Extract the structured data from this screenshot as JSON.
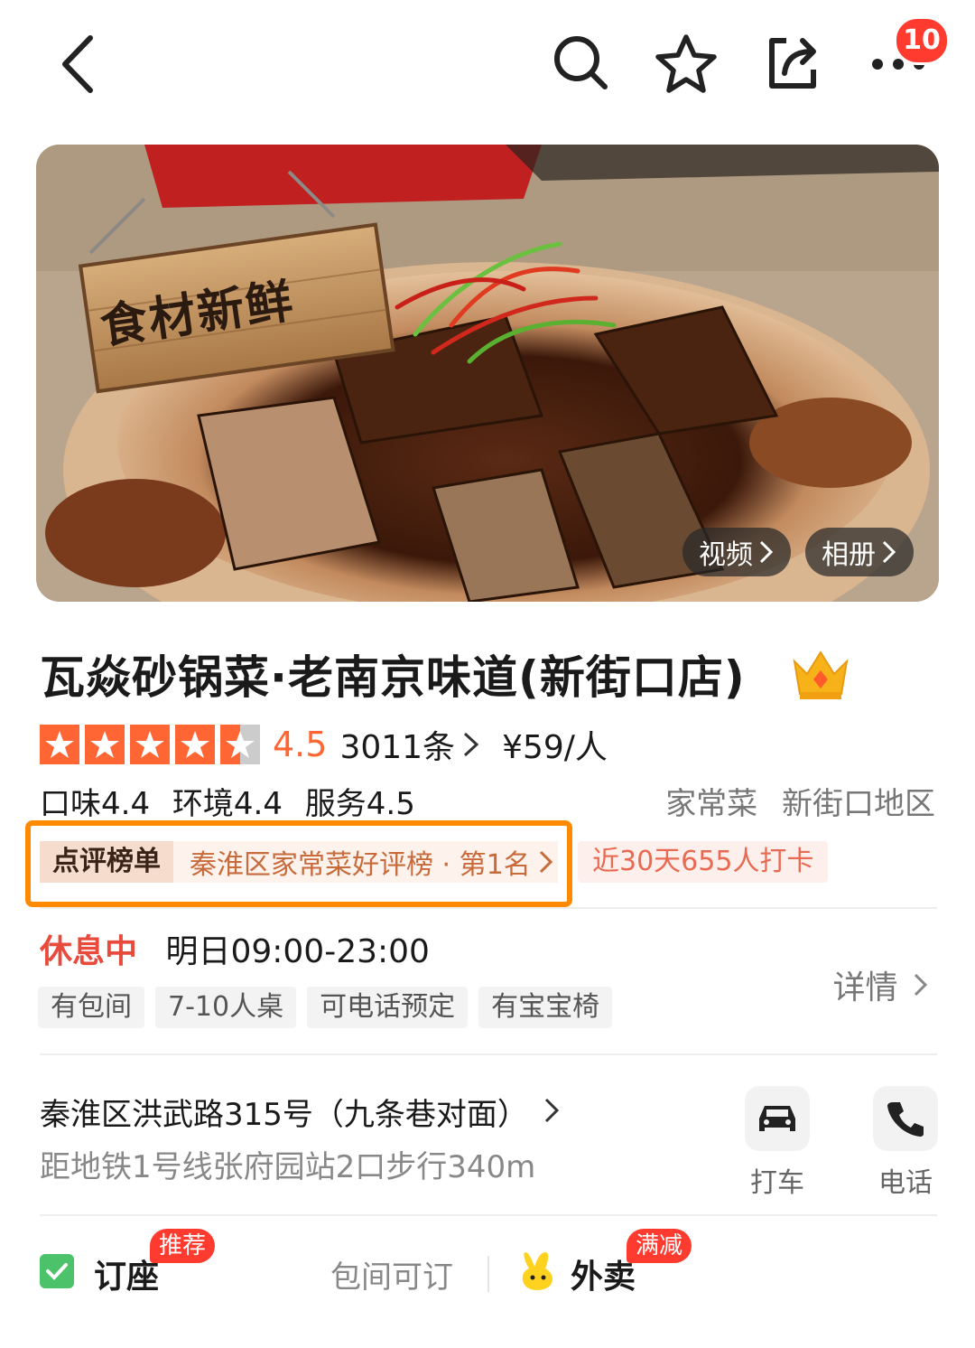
{
  "topbar": {
    "notification_count": "10",
    "icons": [
      "back-arrow-icon",
      "search-icon",
      "star-outline-icon",
      "share-icon",
      "more-dots-icon"
    ]
  },
  "hero": {
    "sign_text": "食材新鲜",
    "video_label": "视频",
    "album_label": "相册"
  },
  "restaurant": {
    "name": "瓦焱砂锅菜·老南京味道(新街口店)",
    "rating": "4.5",
    "stars": 4.5,
    "review_count": "3011条",
    "price": "¥59/人",
    "taste": "口味4.4",
    "environment": "环境4.4",
    "service": "服务4.5",
    "category": "家常菜",
    "area": "新街口地区"
  },
  "ranking": {
    "tag": "点评榜单",
    "text": "秦淮区家常菜好评榜 · 第1名",
    "checkin": "近30天655人打卡"
  },
  "hours": {
    "status": "休息中",
    "time": "明日09:00-23:00",
    "detail_label": "详情"
  },
  "facility_tags": [
    "有包间",
    "7-10人桌",
    "可电话预定",
    "有宝宝椅"
  ],
  "location": {
    "address": "秦淮区洪武路315号（九条巷对面）",
    "subway": "距地铁1号线张府园站2口步行340m",
    "taxi_label": "打车",
    "phone_label": "电话"
  },
  "services": {
    "booking_label": "订座",
    "booking_badge": "推荐",
    "room_label": "包间可订",
    "delivery_label": "外卖",
    "delivery_badge": "满减"
  },
  "colors": {
    "accent": "#ff6633",
    "highlight_border": "#ff8a00",
    "closed": "#e84a3c",
    "badge": "#ff3b30"
  }
}
